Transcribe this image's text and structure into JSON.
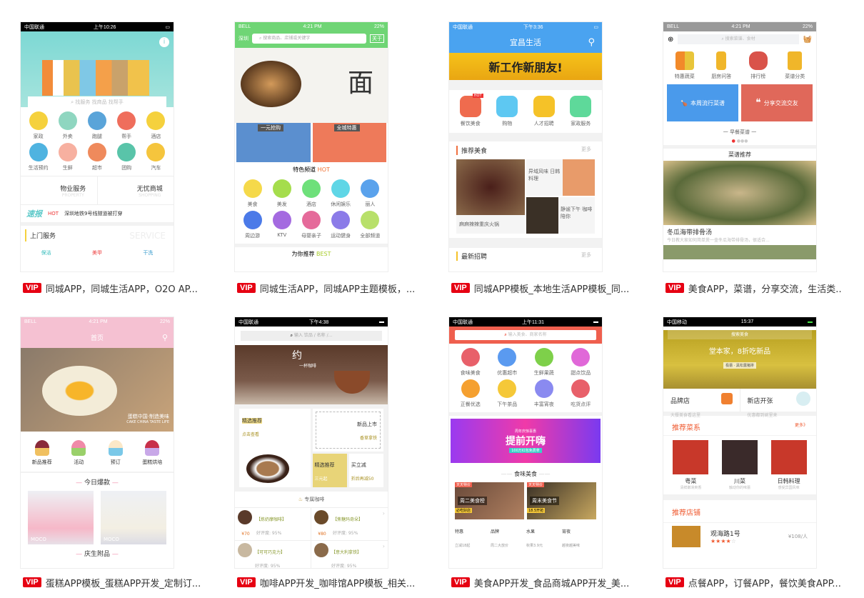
{
  "vip_label": "VIP",
  "cards": [
    {
      "caption": "同城APP，同城生活APP，O2O AP...",
      "status": {
        "left": "中国联通",
        "time": "上午10:26"
      },
      "search_placeholder": "找服务 找商品 找帮手",
      "icons": [
        "家政",
        "外卖",
        "跑腿",
        "帮手",
        "酒店",
        "生活预约",
        "生鲜",
        "超市",
        "团购",
        "汽车"
      ],
      "promo": [
        {
          "title": "物业服务",
          "sub": "PROPERTY"
        },
        {
          "title": "无忧商城",
          "sub": "SHOPPING"
        }
      ],
      "news_tag": "速报",
      "news_hot": "HOT",
      "news_text": "深圳地铁9号线隧道被打穿",
      "section": "上门服务",
      "section_bg": "SERVICE",
      "services": [
        "保洁",
        "美甲",
        "干洗"
      ]
    },
    {
      "caption": "同城生活APP，同城APP主题模板，...",
      "status": {
        "left": "BELL",
        "time": "4:21 PM",
        "battery": "22%"
      },
      "city": "深圳",
      "search_placeholder": "搜索商品、店铺或关键字",
      "about": "关于",
      "tiles": [
        "一元抢购",
        "全城特惠"
      ],
      "channel_title": "特色频道",
      "channel_hot": "HOT",
      "icons": [
        "美食",
        "美发",
        "酒店",
        "休闲娱乐",
        "丽人",
        "周边游",
        "KTV",
        "母婴亲子",
        "运动健身",
        "全部频道"
      ],
      "recommend_title": "为你推荐",
      "recommend_best": "BEST"
    },
    {
      "caption": "同城APP模板_本地生活APP模板_同...",
      "status": {
        "left": "中国联通",
        "time": "下午3:36"
      },
      "title": "宜昌生活",
      "banner": "新工作新朋友!",
      "icons": [
        "餐饮美食",
        "购物",
        "人才招聘",
        "家政服务"
      ],
      "hot_badge": "HOT",
      "section1": "推荐美食",
      "more": "更多",
      "foods": [
        "麻麻辣辣重庆火锅",
        "异域风味 日韩料理",
        "静谧下午 咖啡陪你"
      ],
      "section2": "最新招聘"
    },
    {
      "caption": "美食APP，菜谱，分享交流，生活类..",
      "status": {
        "left": "BELL",
        "time": "4:21 PM",
        "battery": "22%"
      },
      "search_placeholder": "搜索菜谱、食材",
      "icons": [
        "特惠蔬菜",
        "厨房问答",
        "排行榜",
        "菜谱分类"
      ],
      "blue_tile": "本周流行菜谱",
      "red_tile": "分享交流交友",
      "breakfast": "一 早餐菜谱 一",
      "recommend": "菜谱推荐",
      "dish_title": "冬瓜海带排骨汤",
      "dish_desc": "今日教大家如何简单煲一壶冬瓜海带排骨汤，很适合..."
    },
    {
      "caption": "蛋糕APP模板_蛋糕APP开发_定制订...",
      "status": {
        "left": "BELL",
        "time": "4:21 PM",
        "battery": "22%"
      },
      "title": "首页",
      "banner_cn": "蛋糕中国·制造美味",
      "banner_en": "CAKE CHINA TASTE LIFE",
      "icons": [
        "新品推荐",
        "活动",
        "预订",
        "蛋糕烘培"
      ],
      "section1": "今日爆款",
      "brand": "MOCO",
      "section2": "庆生附品"
    },
    {
      "caption": "咖啡APP开发_咖啡馆APP模板_相关...",
      "status": {
        "left": "中国联通",
        "time": "下午4:38"
      },
      "search_placeholder": "输入 饮品 / 名称 /...",
      "banner": "约",
      "banner_sub": "一杯咖啡",
      "pick_title": "精选推荐",
      "pick_sub": "点击查看",
      "new_title": "新品上市",
      "new_sub": "香草拿铁",
      "pick2_title": "精选推荐",
      "pick2_sub": "三元起",
      "deal_title": "买立减",
      "deal_sub": "折后再减50",
      "section": "专属咖啡",
      "items": [
        {
          "name": "【炼奶摩咖啡】",
          "rating": "好评度: 95%",
          "price": "¥70"
        },
        {
          "name": "【焦糖玛奇朵】",
          "rating": "好评度: 95%",
          "price": "¥80"
        },
        {
          "name": "【可可巧克力】",
          "rating": "好评度: 95%",
          "price": ""
        },
        {
          "name": "【意大利拿铁】",
          "rating": "好评度: 95%",
          "price": ""
        }
      ]
    },
    {
      "caption": "美食APP开发_食品商城APP开发_美...",
      "status": {
        "left": "中国联通",
        "time": "上午11:31"
      },
      "search_placeholder": "输入美食、商家名称",
      "icons": [
        "食味美食",
        "优惠超市",
        "生鲜果蔬",
        "甜点饮品",
        "正餐优选",
        "下午茶品",
        "丰富宵夜",
        "吃货点评"
      ],
      "banner": "提前开嗨",
      "banner_top": "周年庆惊喜惠",
      "banner_sub": "100万红包免费拿",
      "section": "食味美食",
      "promo_tag": "天天特价",
      "promos": [
        {
          "title": "周二美食榜",
          "tag": "必吃好店"
        },
        {
          "title": "周末美食节",
          "tag": "18.5开抢"
        }
      ],
      "mini": [
        {
          "t": "特惠",
          "s": "立减18起"
        },
        {
          "t": "品牌",
          "s": "周二大放价"
        },
        {
          "t": "水果",
          "s": "秋果3.9元"
        },
        {
          "t": "宵夜",
          "s": "越夜越美味"
        }
      ]
    },
    {
      "caption": "点餐APP，订餐APP，餐饮美食APP...",
      "status": {
        "left": "中国移动",
        "time": "15:37"
      },
      "search_placeholder": "搜索美食",
      "banner": "堂本家，8折吃新品",
      "banner_sub": "极蕾 · 黑松露猪排",
      "brand_title": "品牌店",
      "brand_sub": "大餐美食看这里",
      "new_title": "新店开张",
      "new_sub": "优惠都到碗里来",
      "section1": "推荐菜系",
      "more": "更多》",
      "cuisines": [
        {
          "t": "粤菜",
          "s": "清鲜嫩滑爽香"
        },
        {
          "t": "川菜",
          "s": "触动你的味蕾"
        },
        {
          "t": "日韩料理",
          "s": "感受异国风味"
        }
      ],
      "section2": "推荐店铺",
      "shop": "观海路1号",
      "rating_stars": 4,
      "rating_max": 5,
      "price": "¥108/人"
    }
  ]
}
